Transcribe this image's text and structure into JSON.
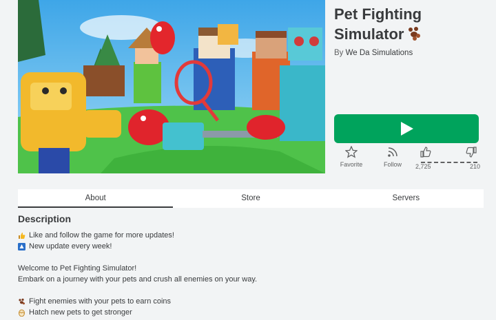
{
  "game": {
    "title": "Pet Fighting Simulator",
    "creator_prefix": "By",
    "creator_name": "We Da Simulations"
  },
  "play_button": {
    "icon": "play-icon",
    "color": "#00a35c"
  },
  "actions": {
    "favorite_label": "Favorite",
    "follow_label": "Follow",
    "upvotes": "2,725",
    "downvotes": "210"
  },
  "tabs": [
    {
      "label": "About",
      "active": true
    },
    {
      "label": "Store",
      "active": false
    },
    {
      "label": "Servers",
      "active": false
    }
  ],
  "description": {
    "heading": "Description",
    "lines": [
      {
        "icon": "thumbs-up-emoji",
        "text": "Like and follow the game for more updates!"
      },
      {
        "icon": "new-badge-emoji",
        "text": "New update every week!"
      },
      {
        "icon": "",
        "text": ""
      },
      {
        "icon": "",
        "text": "Welcome to Pet Fighting Simulator!"
      },
      {
        "icon": "",
        "text": "Embark on a journey with your pets and crush all enemies on your way."
      },
      {
        "icon": "",
        "text": ""
      },
      {
        "icon": "paw-emoji",
        "text": "Fight enemies with your pets to earn coins"
      },
      {
        "icon": "egg-emoji",
        "text": "Hatch new pets to get stronger"
      }
    ]
  }
}
